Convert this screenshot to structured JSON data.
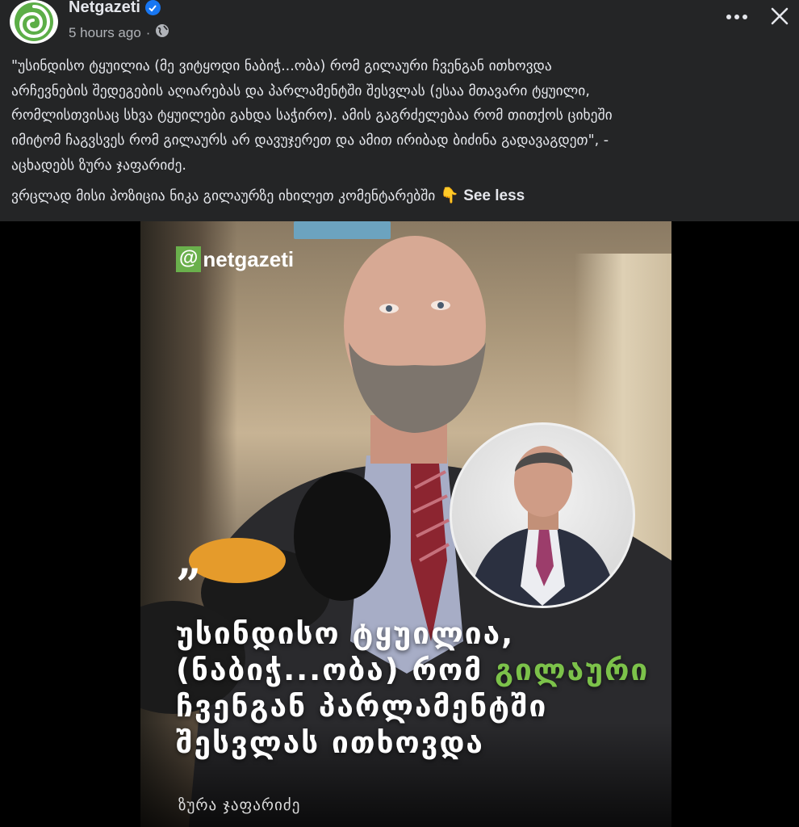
{
  "post": {
    "page_name": "Netgazeti",
    "timestamp": "5 hours ago",
    "separator": "·",
    "audience_icon": "globe-icon",
    "caption_lines": [
      "\"უსინდისო ტყუილია (მე ვიტყოდი ნაბიჭ...ობა) რომ გილაური ჩვენგან ითხოვდა",
      "არჩევნების შედეგების აღიარებას და პარლამენტში შესვლას (ესაა მთავარი ტყუილი,",
      "რომლისთვისაც სხვა ტყუილები გახდა საჭირო). ამის გაგრძელებაა რომ თითქოს ციხეში",
      "იმიტომ ჩაგვსვეს რომ გილაურს არ დავუჯერეთ და ამით ირიბად ბიძინა გადავაგდეთ\", -",
      "აცხადებს ზურა ჯაფარიძე."
    ],
    "caption_more": "ვრცლად მისი პოზიცია ნიკა გილაურზე იხილეთ კომენტარებში",
    "caption_more_emoji": "👇",
    "see_less_label": "See less"
  },
  "image": {
    "brand_logo_prefix": "@",
    "brand_logo_text": "netgazeti",
    "quote_mark": "”",
    "headline": {
      "line1": "უსინდისო ტყუილია,",
      "line2_a": "(ნაბიჭ...ობა) რომ ",
      "line2_accent": "გილაური",
      "line3": "ჩვენგან  პარლამენტში",
      "line4": "შესვლას ითხოვდა"
    },
    "byline": "ზურა ჯაფარიძე"
  },
  "colors": {
    "header_bg": "#242526",
    "accent_green": "#7cc24a",
    "verified_blue": "#1877f2"
  },
  "icons": {
    "verified": "verified-badge-icon",
    "more": "more-options-icon",
    "close": "close-icon"
  }
}
